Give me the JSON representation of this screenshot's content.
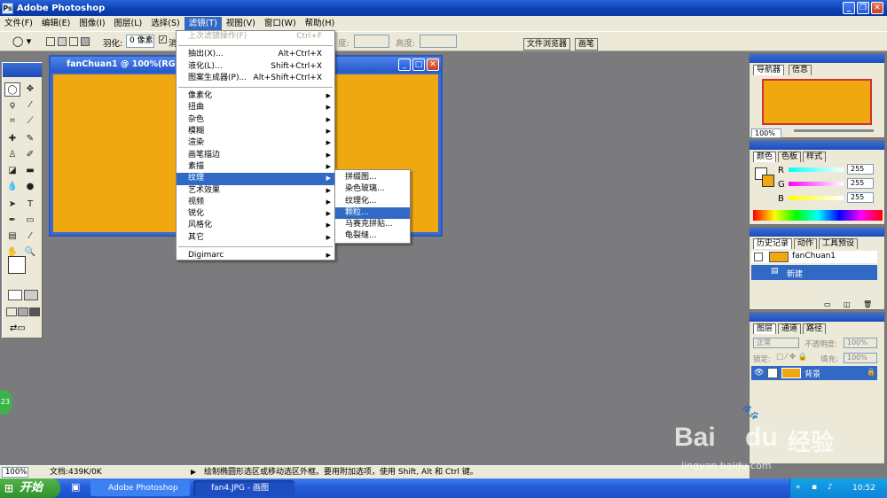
{
  "app": {
    "title": "Adobe Photoshop"
  },
  "menubar": {
    "items": [
      "文件(F)",
      "编辑(E)",
      "图像(I)",
      "图层(L)",
      "选择(S)",
      "滤镜(T)",
      "视图(V)",
      "窗口(W)",
      "帮助(H)"
    ]
  },
  "options": {
    "feather_label": "羽化:",
    "feather_value": "0 像素",
    "antialias_label": "消",
    "width_label": "度:",
    "height_label": "高度:",
    "tab_file_browser": "文件浏览器",
    "tab_brushes": "画笔"
  },
  "document": {
    "title": "fanChuan1 @ 100%(RGB)",
    "fill_color": "#f0a810"
  },
  "filter_menu": {
    "last_filter": {
      "label": "上次滤镜操作(F)",
      "shortcut": "Ctrl+F"
    },
    "top": [
      {
        "label": "抽出(X)...",
        "shortcut": "Alt+Ctrl+X"
      },
      {
        "label": "液化(L)...",
        "shortcut": "Shift+Ctrl+X"
      },
      {
        "label": "图案生成器(P)...",
        "shortcut": "Alt+Shift+Ctrl+X"
      }
    ],
    "groups": [
      "像素化",
      "扭曲",
      "杂色",
      "模糊",
      "渲染",
      "画笔描边",
      "素描",
      "纹理",
      "艺术效果",
      "视频",
      "锐化",
      "风格化",
      "其它"
    ],
    "selected_group": "纹理",
    "digimarc": "Digimarc"
  },
  "texture_submenu": {
    "items": [
      "拼缀图...",
      "染色玻璃...",
      "纹理化...",
      "颗粒...",
      "马赛克拼贴...",
      "龟裂缝..."
    ],
    "selected": "颗粒..."
  },
  "navigator_panel": {
    "tabs": [
      "导航器",
      "信息"
    ],
    "zoom": "100%"
  },
  "color_panel": {
    "tabs": [
      "颜色",
      "色板",
      "样式"
    ],
    "channels": [
      {
        "label": "R",
        "value": "255"
      },
      {
        "label": "G",
        "value": "255"
      },
      {
        "label": "B",
        "value": "255"
      }
    ]
  },
  "history_panel": {
    "tabs": [
      "历史记录",
      "动作",
      "工具预设"
    ],
    "snapshot": "fanChuan1",
    "state": "新建"
  },
  "layers_panel": {
    "tabs": [
      "图层",
      "通道",
      "路径"
    ],
    "blend_mode": "正常",
    "opacity_label": "不透明度:",
    "opacity_value": "100%",
    "lock_label": "锁定:",
    "fill_label": "填充:",
    "fill_value": "100%",
    "layer_name": "背景"
  },
  "status": {
    "zoom": "100%",
    "doc_info": "文档:439K/0K",
    "hint": "绘制椭圆形选区或移动选区外框。要用附加选项，使用 Shift, Alt 和 Ctrl 键。"
  },
  "taskbar": {
    "start": "开始",
    "items": [
      "Adobe Photoshop",
      "fan4.JPG - 画图"
    ],
    "clock": "10:52"
  },
  "badge": {
    "text": "23"
  },
  "watermark": {
    "brand": "Bai",
    "brand2": "du",
    "suffix": "经验",
    "url": "jingyan.baidu.com"
  },
  "colors": {
    "accent": "#316ac5",
    "title_blue": "#0a3fb0",
    "document_fill": "#f0a810"
  }
}
